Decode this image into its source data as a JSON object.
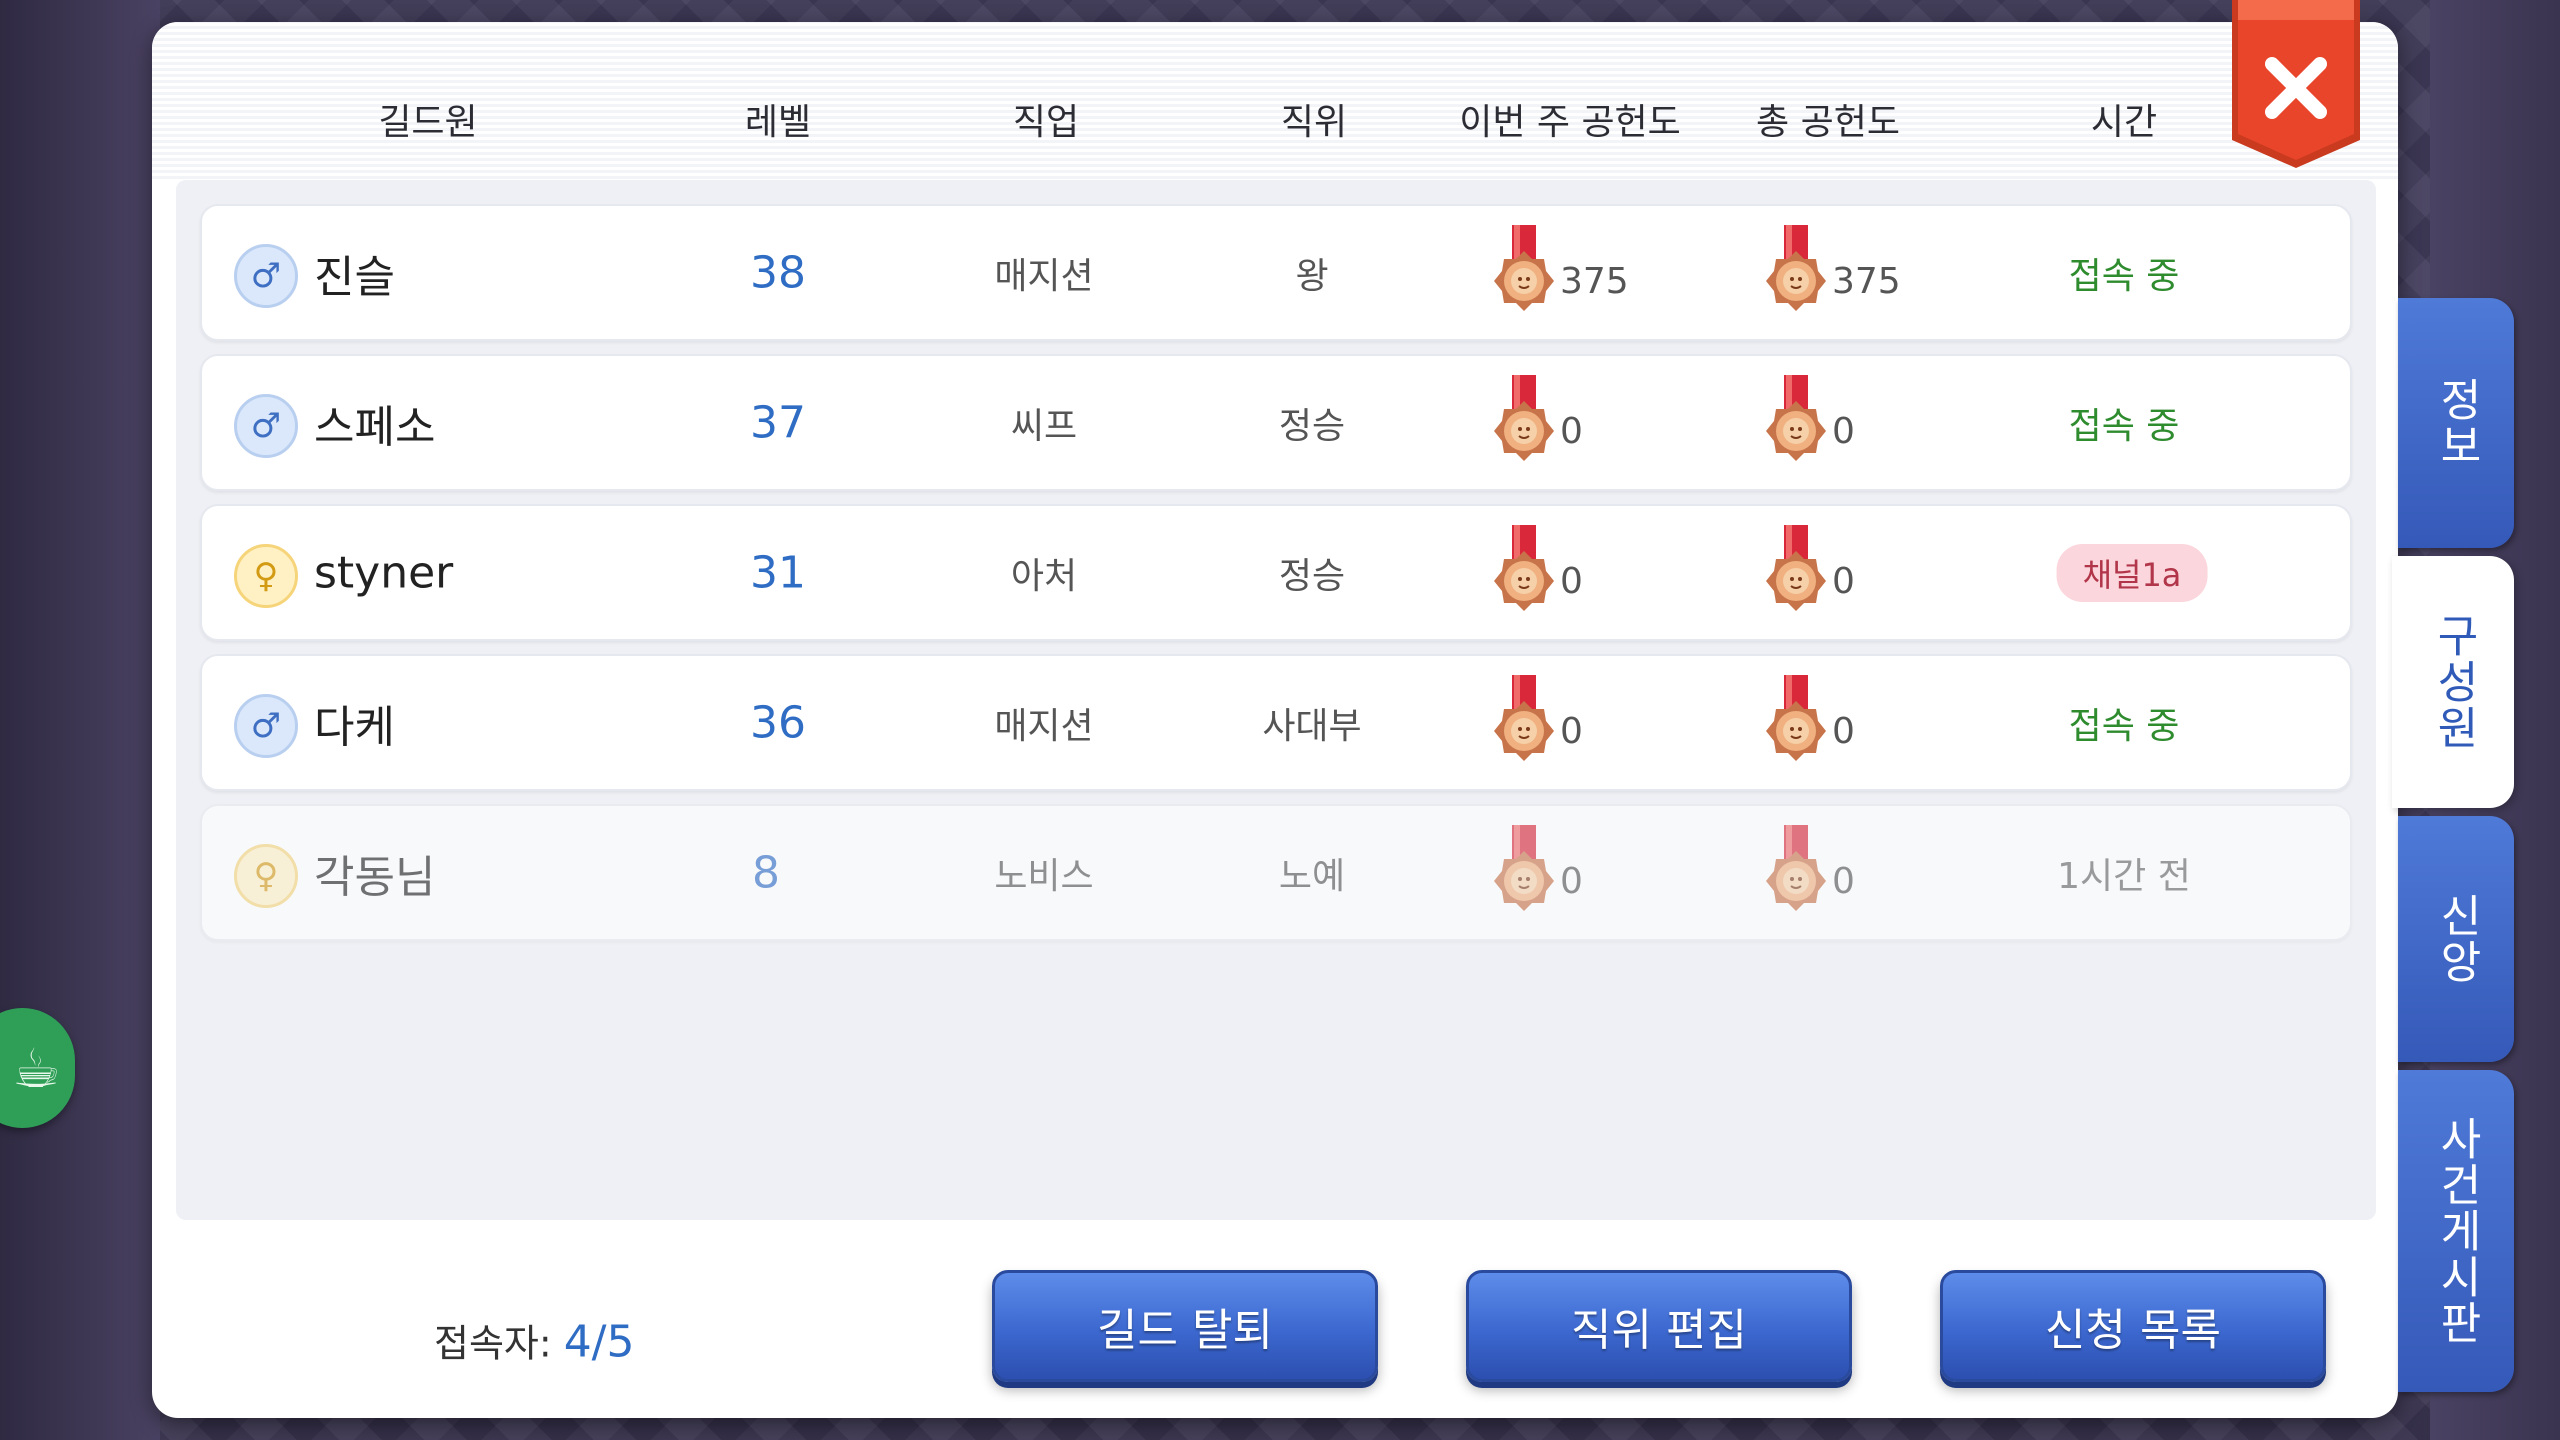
{
  "headers": {
    "member": "길드원",
    "level": "레벨",
    "job": "직업",
    "rank": "직위",
    "weekly": "이번 주 공헌도",
    "total": "총 공헌도",
    "time": "시간"
  },
  "members": [
    {
      "gender": "male",
      "gender_icon": "♂",
      "name": "진슬",
      "level": "38",
      "job": "매지션",
      "rank": "왕",
      "weekly": "375",
      "total": "375",
      "status": "접속 중",
      "status_type": "online"
    },
    {
      "gender": "male",
      "gender_icon": "♂",
      "name": "스페소",
      "level": "37",
      "job": "씨프",
      "rank": "정승",
      "weekly": "0",
      "total": "0",
      "status": "접속 중",
      "status_type": "online"
    },
    {
      "gender": "female",
      "gender_icon": "♀",
      "name": "styner",
      "level": "31",
      "job": "아처",
      "rank": "정승",
      "weekly": "0",
      "total": "0",
      "status": "채널1a",
      "status_type": "channel"
    },
    {
      "gender": "male",
      "gender_icon": "♂",
      "name": "다케",
      "level": "36",
      "job": "매지션",
      "rank": "사대부",
      "weekly": "0",
      "total": "0",
      "status": "접속 중",
      "status_type": "online"
    },
    {
      "gender": "female",
      "gender_icon": "♀",
      "name": "각동님",
      "level": "8",
      "job": "노비스",
      "rank": "노예",
      "weekly": "0",
      "total": "0",
      "status": "1시간 전",
      "status_type": "offline"
    }
  ],
  "footer": {
    "online_label": "접속자:",
    "online_count": "4/5",
    "leave_button": "길드 탈퇴",
    "edit_rank_button": "직위 편집",
    "applications_button": "신청 목록"
  },
  "tabs": [
    "정보",
    "구성원",
    "신앙",
    "사건게시판"
  ],
  "active_tab": "구성원",
  "icons": {
    "close": "close-icon",
    "medal": "medal-icon",
    "side": "cup-icon"
  },
  "colors": {
    "accent_blue": "#2f6cc4",
    "online_green": "#2e8b2e",
    "close_red": "#e8452a",
    "button_blue": "#3c68cf"
  }
}
